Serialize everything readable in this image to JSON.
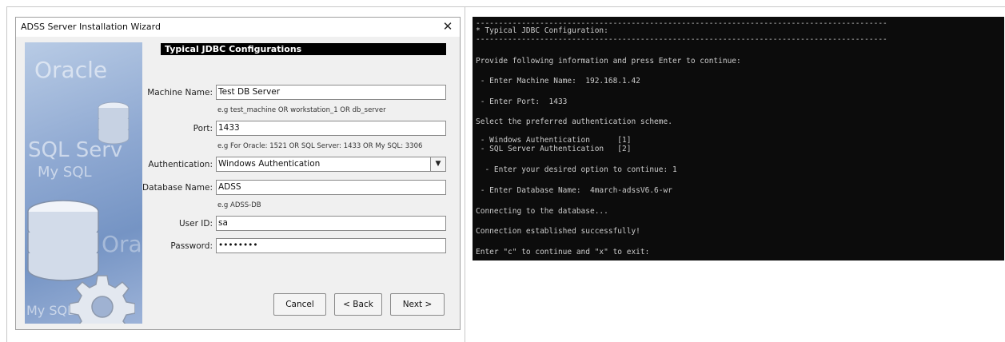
{
  "wizard": {
    "title": "ADSS Server Installation Wizard",
    "close_glyph": "✕",
    "side_image_text": [
      "Oracle",
      "SQL Serv",
      "My SQL",
      "Orac",
      "My SQL"
    ],
    "section_header": "Typical JDBC Configurations",
    "fields": {
      "machine_name": {
        "label": "Machine Name:",
        "value": "Test DB Server",
        "hint": "e.g test_machine OR workstation_1 OR db_server"
      },
      "port": {
        "label": "Port:",
        "value": "1433",
        "hint": "e.g For Oracle: 1521 OR SQL Server: 1433 OR  My SQL: 3306"
      },
      "authentication": {
        "label": "Authentication:",
        "value": "Windows Authentication",
        "arrow": "▼"
      },
      "database_name": {
        "label": "Database Name:",
        "value": "ADSS",
        "hint": "e.g ADSS-DB"
      },
      "user_id": {
        "label": "User ID:",
        "value": "sa"
      },
      "password": {
        "label": "Password:",
        "value": "••••••••"
      }
    },
    "buttons": {
      "cancel": "Cancel",
      "back": "< Back",
      "next": "Next >"
    }
  },
  "console": {
    "lines": [
      "------------------------------------------------------------------------------------------",
      "* Typical JDBC Configuration:",
      "------------------------------------------------------------------------------------------",
      "Provide following information and press Enter to continue:",
      " - Enter Machine Name:  192.168.1.42",
      " - Enter Port:  1433",
      "Select the preferred authentication scheme.",
      " - Windows Authentication      [1]",
      " - SQL Server Authentication   [2]",
      "  - Enter your desired option to continue: 1",
      " - Enter Database Name:  4march-adssV6.6-wr",
      "Connecting to the database...",
      "Connection established successfully!",
      "Enter \"c\" to continue and \"x\" to exit:"
    ]
  },
  "colors": {
    "console_bg": "#0c0c0c",
    "console_text": "#cccccc",
    "dialog_bg": "#f0f0f0",
    "header_bg": "#000000"
  }
}
